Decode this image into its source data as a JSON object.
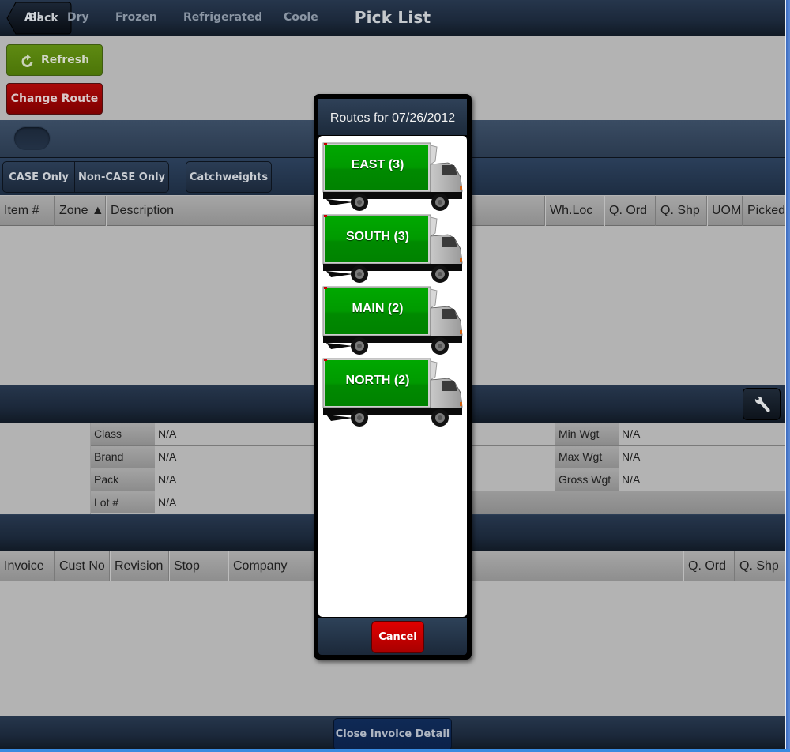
{
  "header": {
    "title": "Pick List",
    "back_label": "Back"
  },
  "actions": {
    "refresh_label": "Refresh",
    "change_route_label": "Change Route"
  },
  "zone_tabs": [
    {
      "label": "All",
      "active": true
    },
    {
      "label": "Dry",
      "active": false
    },
    {
      "label": "Frozen",
      "active": false
    },
    {
      "label": "Refrigerated",
      "active": false
    },
    {
      "label": "Coole",
      "active": false
    }
  ],
  "case_filters": {
    "case_only": "CASE Only",
    "non_case_only": "Non-CASE Only",
    "catchweights": "Catchweights"
  },
  "items_table": {
    "columns": [
      "Item #",
      "Zone ▲",
      "Description",
      "Wh.Loc",
      "Q. Ord",
      "Q. Shp",
      "UOM",
      "Picked"
    ],
    "sort": {
      "column": "Zone",
      "direction": "ascending"
    },
    "rows": []
  },
  "item_detail": {
    "left": [
      {
        "label": "Class",
        "value": "N/A"
      },
      {
        "label": "Brand",
        "value": "N/A"
      },
      {
        "label": "Pack",
        "value": "N/A"
      },
      {
        "label": "Lot #",
        "value": "N/A"
      }
    ],
    "right": [
      {
        "label": "Min Wgt",
        "value": "N/A"
      },
      {
        "label": "Max Wgt",
        "value": "N/A"
      },
      {
        "label": "Gross Wgt",
        "value": "N/A"
      }
    ],
    "tool_icon": "wrench-icon"
  },
  "invoice_table": {
    "columns": [
      "Invoice",
      "Cust No",
      "Revision",
      "Stop",
      "Company",
      "Q. Ord",
      "Q. Shp"
    ],
    "rows": []
  },
  "footer": {
    "close_invoice_label": "Close Invoice Detail"
  },
  "routes_modal": {
    "title": "Routes for 07/26/2012",
    "routes": [
      {
        "label": "EAST (3)",
        "name": "EAST",
        "count": 3
      },
      {
        "label": "SOUTH (3)",
        "name": "SOUTH",
        "count": 3
      },
      {
        "label": "MAIN (2)",
        "name": "MAIN",
        "count": 2
      },
      {
        "label": "NORTH (2)",
        "name": "NORTH",
        "count": 2
      }
    ],
    "cancel_label": "Cancel"
  },
  "colors": {
    "header_bar": "#1b283a",
    "refresh_green": "#557f0d",
    "change_route_red": "#950404",
    "truck_green": "#00a000",
    "cancel_red": "#cc0000",
    "close_invoice_blue": "#0d2550",
    "background": "#b3b3b3"
  }
}
